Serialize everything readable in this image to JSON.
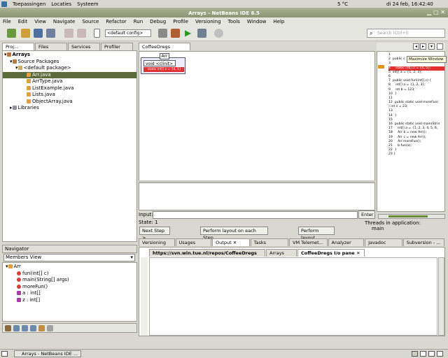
{
  "topbar": {
    "apps": "Toepassingen",
    "places": "Locaties",
    "system": "Systeem",
    "weather": "5 °C",
    "datetime": "di 24 feb, 16:42:40"
  },
  "window": {
    "title": "Arrays - NetBeans IDE 6.5"
  },
  "menu": [
    "File",
    "Edit",
    "View",
    "Navigate",
    "Source",
    "Refactor",
    "Run",
    "Debug",
    "Profile",
    "Versioning",
    "Tools",
    "Window",
    "Help"
  ],
  "toolbar": {
    "config": "<default config>",
    "search_placeholder": "Search (Ctrl+I)"
  },
  "projects": {
    "tabs": [
      "Proj...",
      "Files",
      "Services",
      "Profiler"
    ],
    "tree": [
      "Arrays",
      "Source Packages",
      "<default package>",
      "Arr.java",
      "ArrType.java",
      "ListExample.java",
      "Lists.java",
      "ObjectArray.java",
      "Libraries"
    ]
  },
  "navigator": {
    "title": "Navigator",
    "view": "Members View",
    "class": "Arr",
    "members": [
      "fun(int[] c)",
      "main(String[] args)",
      "moreFun()",
      "a : int[]",
      "z : int[]"
    ]
  },
  "cd": {
    "tab": "CoffeeDregs Window",
    "arr_label": "Arr",
    "clinit": "void <clinit>()",
    "static_row": "static int[] z = {4, 5}",
    "input_label": "Input:",
    "enter": "Enter",
    "state": "State: 1",
    "next_step": "Next Step >",
    "layout_each": "Perform layout on each Step",
    "layout": "Perform layout",
    "threads_label": "Threads in application:",
    "thread": "main"
  },
  "code": {
    "tooltip": "Maximize Window",
    "lines": [
      "1",
      "2  public c",
      "3",
      "4     static int[] z = {4, 5};",
      "5  int[] a = {1, 2, 3};",
      "6",
      "7  public void fun(int[] c) {",
      "8     int[] a = {1, 2, 3};",
      "9     int b = 123;",
      "10  }",
      "11",
      "12  public static void moreFun(",
      ") int ii = 23;",
      "13",
      "14  }",
      "15",
      "16  public static void main(Strin",
      "17     int[] a = {1, 2, 3, 4, 5, 6,",
      "18     Arr b = new Arr();",
      "19     Arr c = new Arr();",
      "20     Arr.moreFun();",
      "21     b.fun(a);",
      "22  }",
      "23 }"
    ]
  },
  "bottom": {
    "tabs": [
      "Versioning O...",
      "Usages",
      "Output",
      "Tasks",
      "VM Telemet...",
      "Analyzer",
      "Javadoc",
      "Subversion - ..."
    ],
    "subtabs": [
      "https://svn.win.tue.nl/repos/CoffeeDregs",
      "Arrays (jar)",
      "CoffeeDregs I/o pane"
    ]
  },
  "status": {
    "task": "Arrays - NetBeans IDE ..."
  },
  "colors": {
    "selection": "#5a6a3a",
    "highlight": "#e03030",
    "accent": "#8c9474"
  }
}
